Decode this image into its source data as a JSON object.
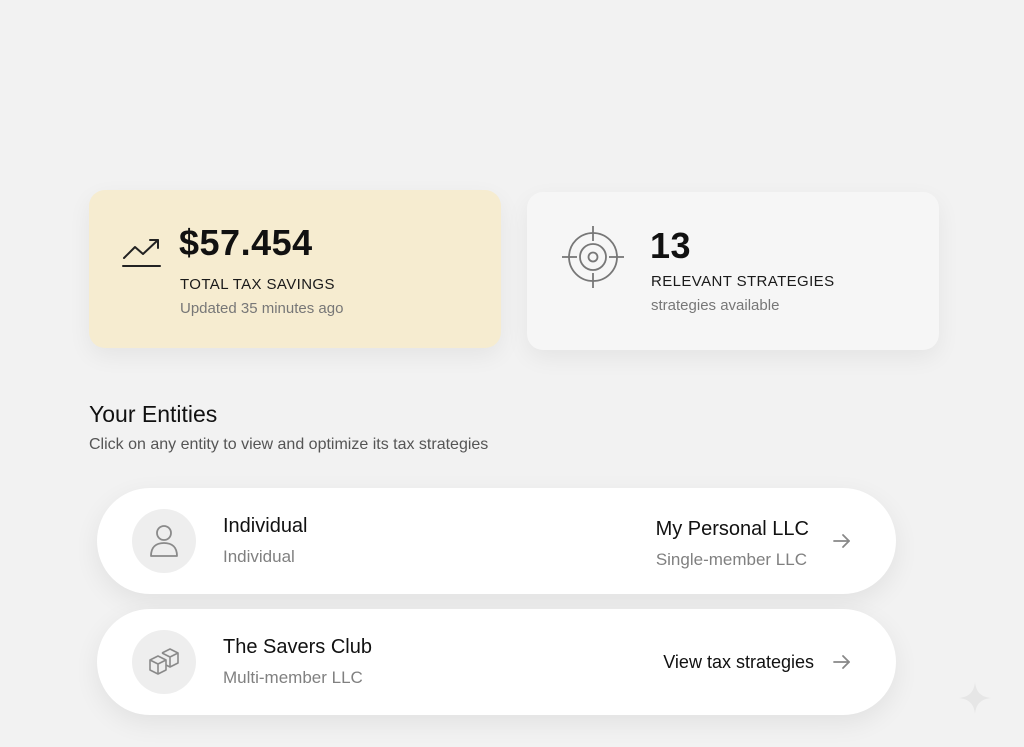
{
  "summary": {
    "savings": {
      "amount": "$57.454",
      "label": "TOTAL TAX SAVINGS",
      "updated": "Updated 35 minutes ago",
      "icon": "trending-up-icon",
      "background": "#f6ecd0"
    },
    "strategies": {
      "count": "13",
      "label": "RELEVANT STRATEGIES",
      "sub": "strategies available",
      "icon": "target-icon",
      "background": "#f6f6f6"
    }
  },
  "entities_section": {
    "title": "Your Entities",
    "subtitle": "Click on any entity to view and optimize its tax strategies"
  },
  "entities": [
    {
      "name": "Individual",
      "type": "Individual",
      "icon": "user-icon",
      "right_title": "My Personal LLC",
      "right_sub": "Single-member LLC"
    },
    {
      "name": "The Savers Club",
      "type": "Multi-member LLC",
      "icon": "boxes-icon",
      "right_link": "View tax strategies"
    }
  ]
}
